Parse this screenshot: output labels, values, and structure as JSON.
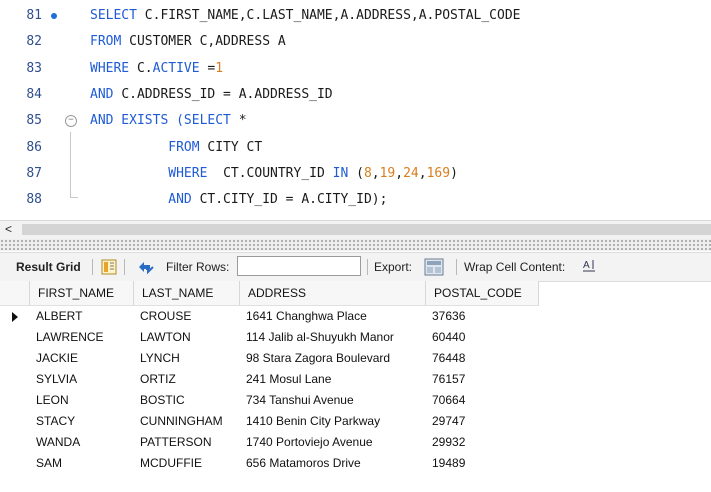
{
  "editor": {
    "lines": [
      {
        "n": "81",
        "parts": [
          {
            "t": "SELECT ",
            "c": "kw"
          },
          {
            "t": "C.FIRST_NAME,C.LAST_NAME,A.ADDRESS,A.POSTAL_CODE",
            "c": "txt"
          }
        ]
      },
      {
        "n": "82",
        "parts": [
          {
            "t": "FROM ",
            "c": "kw"
          },
          {
            "t": "CUSTOMER C,ADDRESS A",
            "c": "txt"
          }
        ]
      },
      {
        "n": "83",
        "parts": [
          {
            "t": "WHERE ",
            "c": "kw"
          },
          {
            "t": "C.",
            "c": "txt"
          },
          {
            "t": "ACTIVE",
            "c": "kw"
          },
          {
            "t": " =",
            "c": "txt"
          },
          {
            "t": "1",
            "c": "num"
          }
        ]
      },
      {
        "n": "84",
        "parts": [
          {
            "t": "AND ",
            "c": "kw"
          },
          {
            "t": "C.ADDRESS_ID = A.ADDRESS_ID",
            "c": "txt"
          }
        ]
      },
      {
        "n": "85",
        "parts": [
          {
            "t": "AND EXISTS (SELECT ",
            "c": "kw"
          },
          {
            "t": "*",
            "c": "txt"
          }
        ]
      },
      {
        "n": "86",
        "parts": [
          {
            "t": "          FROM ",
            "c": "kw"
          },
          {
            "t": "CITY CT",
            "c": "txt"
          }
        ]
      },
      {
        "n": "87",
        "parts": [
          {
            "t": "          WHERE  ",
            "c": "kw"
          },
          {
            "t": "CT.COUNTRY_ID ",
            "c": "txt"
          },
          {
            "t": "IN ",
            "c": "kw"
          },
          {
            "t": "(",
            "c": "txt"
          },
          {
            "t": "8",
            "c": "num"
          },
          {
            "t": ",",
            "c": "txt"
          },
          {
            "t": "19",
            "c": "num"
          },
          {
            "t": ",",
            "c": "txt"
          },
          {
            "t": "24",
            "c": "num"
          },
          {
            "t": ",",
            "c": "txt"
          },
          {
            "t": "169",
            "c": "num"
          },
          {
            "t": ")",
            "c": "txt"
          }
        ]
      },
      {
        "n": "88",
        "parts": [
          {
            "t": "          AND ",
            "c": "kw"
          },
          {
            "t": "CT.CITY_ID = A.CITY_ID);",
            "c": "txt"
          }
        ]
      }
    ]
  },
  "toolbar": {
    "result_grid": "Result Grid",
    "filter_rows": "Filter Rows:",
    "filter_value": "",
    "export": "Export:",
    "wrap": "Wrap Cell Content:"
  },
  "grid": {
    "columns": [
      "FIRST_NAME",
      "LAST_NAME",
      "ADDRESS",
      "POSTAL_CODE"
    ],
    "rows": [
      [
        "ALBERT",
        "CROUSE",
        "1641 Changhwa Place",
        "37636"
      ],
      [
        "LAWRENCE",
        "LAWTON",
        "114 Jalib al-Shuyukh Manor",
        "60440"
      ],
      [
        "JACKIE",
        "LYNCH",
        "98 Stara Zagora Boulevard",
        "76448"
      ],
      [
        "SYLVIA",
        "ORTIZ",
        "241 Mosul Lane",
        "76157"
      ],
      [
        "LEON",
        "BOSTIC",
        "734 Tanshui Avenue",
        "70664"
      ],
      [
        "STACY",
        "CUNNINGHAM",
        "1410 Benin City Parkway",
        "29747"
      ],
      [
        "WANDA",
        "PATTERSON",
        "1740 Portoviejo Avenue",
        "29932"
      ],
      [
        "SAM",
        "MCDUFFIE",
        "656 Matamoros Drive",
        "19489"
      ]
    ]
  },
  "colors": {
    "keyword": "#1f5bd6",
    "number": "#d87e1e",
    "line_number": "#2f4f8f"
  }
}
